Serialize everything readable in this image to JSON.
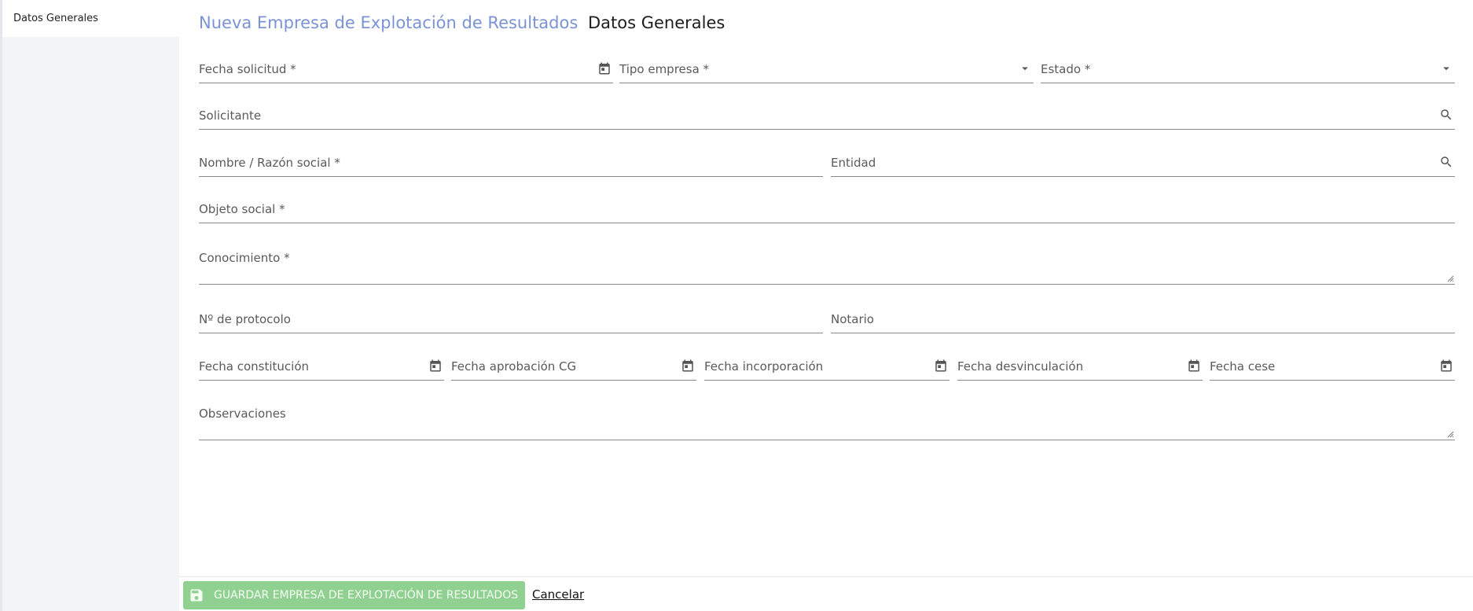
{
  "sidebar": {
    "items": [
      {
        "label": "Datos Generales"
      }
    ]
  },
  "header": {
    "breadcrumb": "Nueva Empresa de Explotación de Resultados",
    "title": "Datos Generales"
  },
  "form": {
    "fecha_solicitud": {
      "label": "Fecha solicitud *",
      "icon": "calendar-icon"
    },
    "tipo_empresa": {
      "label": "Tipo empresa *",
      "icon": "dropdown-arrow-icon"
    },
    "estado": {
      "label": "Estado *",
      "icon": "dropdown-arrow-icon"
    },
    "solicitante": {
      "label": "Solicitante",
      "icon": "search-icon"
    },
    "nombre": {
      "label": "Nombre / Razón social *"
    },
    "entidad": {
      "label": "Entidad",
      "icon": "search-icon"
    },
    "objeto_social": {
      "label": "Objeto social *"
    },
    "conocimiento": {
      "label": "Conocimiento *"
    },
    "protocolo": {
      "label": "Nº de protocolo"
    },
    "notario": {
      "label": "Notario"
    },
    "fecha_constitucion": {
      "label": "Fecha constitución",
      "icon": "calendar-icon"
    },
    "fecha_aprobacion": {
      "label": "Fecha aprobación CG",
      "icon": "calendar-icon"
    },
    "fecha_incorporacion": {
      "label": "Fecha incorporación",
      "icon": "calendar-icon"
    },
    "fecha_desvinculacion": {
      "label": "Fecha desvinculación",
      "icon": "calendar-icon"
    },
    "fecha_cese": {
      "label": "Fecha cese",
      "icon": "calendar-icon"
    },
    "observaciones": {
      "label": "Observaciones"
    }
  },
  "footer": {
    "save_label": "GUARDAR EMPRESA DE EXPLOTACIÓN DE RESULTADOS",
    "cancel_label": "Cancelar"
  },
  "colors": {
    "accent": "#7b93d6",
    "save_button": "#90d090",
    "sidebar_bg": "#f1f5f8"
  }
}
